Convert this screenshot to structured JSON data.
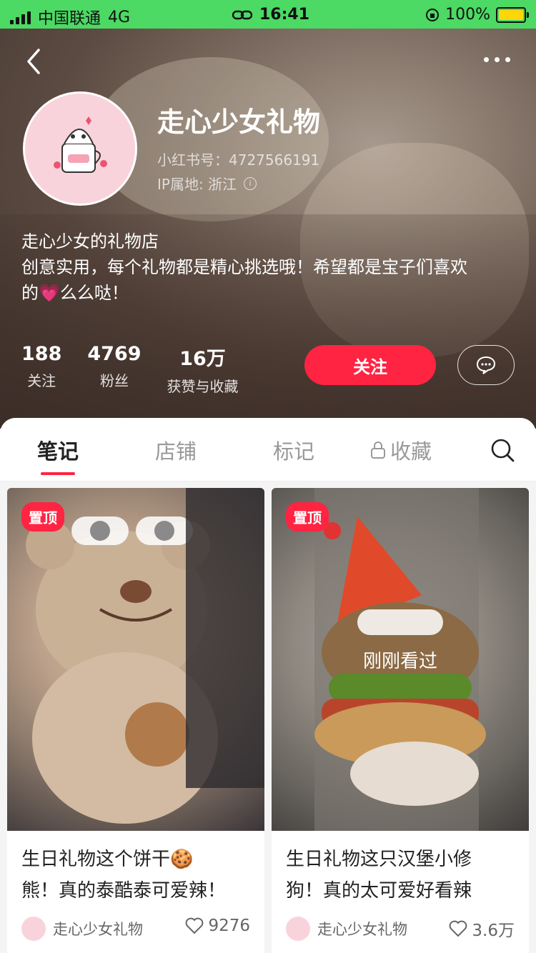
{
  "status_bar": {
    "carrier": "中国联通",
    "network": "4G",
    "time": "16:41",
    "battery": "100%"
  },
  "profile": {
    "name": "走心少女礼物",
    "red_id": "小红书号：4727566191",
    "ip_location": "IP属地: 浙江",
    "bio": {
      "line1": "走心少女的礼物店",
      "line2": "创意实用，每个礼物都是精心挑选哦！希望都是宝子们喜欢",
      "line3": "的💗么么哒！"
    },
    "stats": [
      {
        "value": "188",
        "label": "关注"
      },
      {
        "value": "4769",
        "label": "粉丝"
      },
      {
        "value": "16万",
        "label": "获赞与收藏"
      }
    ],
    "follow_label": "关注"
  },
  "tabs": [
    {
      "label": "笔记",
      "active": true
    },
    {
      "label": "店铺",
      "active": false
    },
    {
      "label": "标记",
      "active": false
    },
    {
      "label": "收藏",
      "active": false,
      "locked": true
    }
  ],
  "notes": [
    {
      "badge": "置顶",
      "overlay": "",
      "title_line1": "生日礼物这个饼干🍪",
      "title_line2": "熊！真的泰酷泰可爱辣！",
      "author": "走心少女礼物",
      "likes": "9276"
    },
    {
      "badge": "置顶",
      "overlay": "刚刚看过",
      "title_line1": "生日礼物这只汉堡小修",
      "title_line2": "狗！真的太可爱好看辣",
      "author": "走心少女礼物",
      "likes": "3.6万"
    }
  ],
  "colors": {
    "accent": "#ff2442",
    "status_bar": "#4cd964"
  }
}
